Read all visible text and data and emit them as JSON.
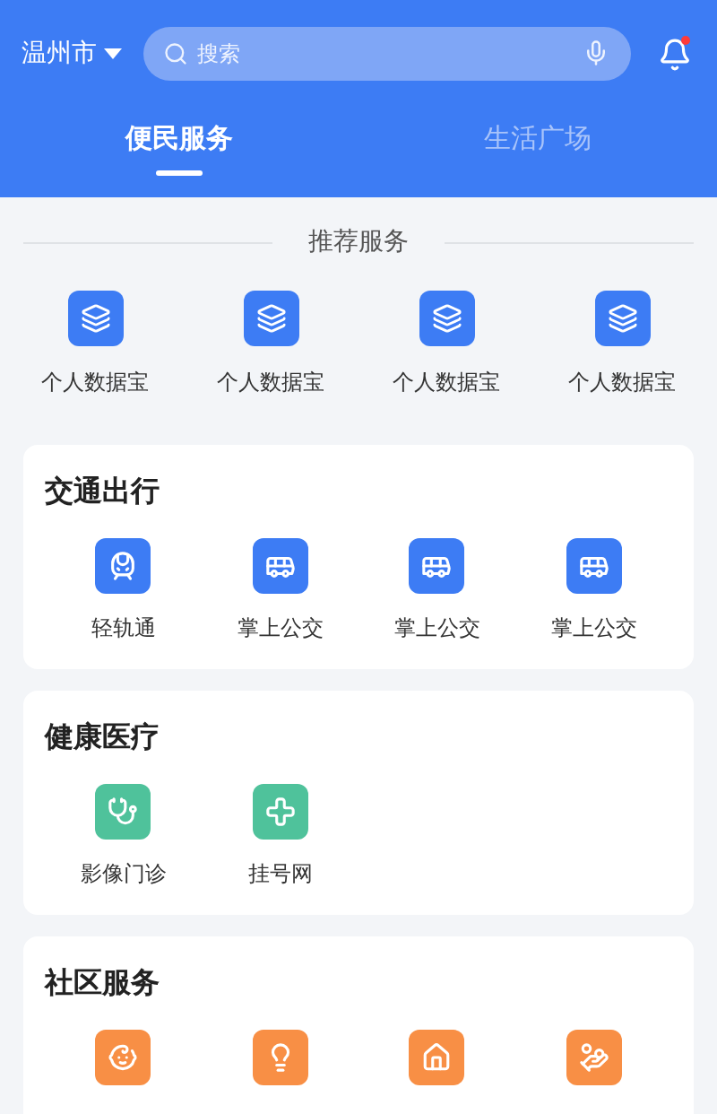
{
  "header": {
    "city": "温州市",
    "search": {
      "placeholder": "搜索"
    },
    "unread": true
  },
  "tabs": [
    {
      "label": "便民服务",
      "selected": true
    },
    {
      "label": "生活广场",
      "selected": false
    }
  ],
  "recommended": {
    "title": "推荐服务",
    "items": [
      {
        "label": "个人数据宝"
      },
      {
        "label": "个人数据宝"
      },
      {
        "label": "个人数据宝"
      },
      {
        "label": "个人数据宝"
      }
    ]
  },
  "sections": [
    {
      "title": "交通出行",
      "color": "#3d7cf4",
      "items": [
        {
          "kind": "labeled",
          "label": "轻轨通"
        },
        {
          "kind": "labeled",
          "label": "掌上公交"
        },
        {
          "kind": "labeled",
          "label": "掌上公交"
        },
        {
          "kind": "labeled",
          "label": "掌上公交"
        }
      ]
    },
    {
      "title": "健康医疗",
      "color": "#4fc29b",
      "items": [
        {
          "kind": "labeled",
          "label": "影像门诊"
        },
        {
          "kind": "labeled",
          "label": "挂号网"
        }
      ]
    },
    {
      "title": "社区服务",
      "color": "#f88f45",
      "items": [
        {
          "kind": "tile"
        },
        {
          "kind": "tile"
        },
        {
          "kind": "tile"
        },
        {
          "kind": "tile"
        }
      ]
    }
  ]
}
